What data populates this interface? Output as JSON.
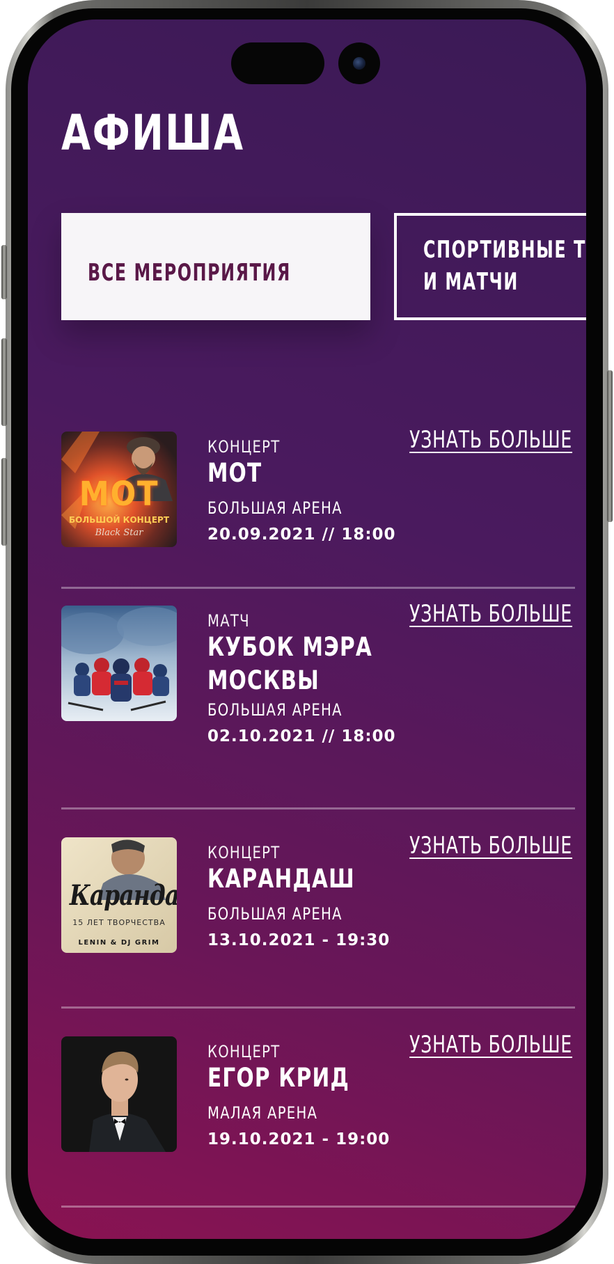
{
  "header": {
    "title": "АФИША"
  },
  "filters": {
    "tabs": [
      {
        "label": "ВСЕ МЕРОПРИЯТИЯ",
        "active": true
      },
      {
        "label": "СПОРТИВНЫЕ ТУ\nИ МАТЧИ",
        "active": false
      }
    ]
  },
  "events": [
    {
      "category": "КОНЦЕРТ",
      "title": "МОТ",
      "venue": "БОЛЬШАЯ АРЕНА",
      "datetime": "20.09.2021 // 18:00",
      "more_label": "УЗНАТЬ БОЛЬШЕ",
      "poster": {
        "text": "МОТ",
        "subtext": "БОЛЬШОЙ КОНЦЕРТ",
        "signature": "Black Star"
      }
    },
    {
      "category": "МАТЧ",
      "title": "КУБОК МЭРА\nМОСКВЫ",
      "venue": "БОЛЬШАЯ АРЕНА",
      "datetime": "02.10.2021 // 18:00",
      "more_label": "УЗНАТЬ БОЛЬШЕ"
    },
    {
      "category": "КОНЦЕРТ",
      "title": "КАРАНДАШ",
      "venue": "БОЛЬШАЯ АРЕНА",
      "datetime": "13.10.2021 - 19:30",
      "more_label": "УЗНАТЬ БОЛЬШЕ",
      "poster": {
        "text": "Карандаш",
        "subtext": "15 ЛЕТ ТВОРЧЕСТВА",
        "guests": "LENIN & DJ GRIM"
      }
    },
    {
      "category": "КОНЦЕРТ",
      "title": "ЕГОР КРИД",
      "venue": "МАЛАЯ АРЕНА",
      "datetime": "19.10.2021 - 19:00",
      "more_label": "УЗНАТЬ БОЛЬШЕ"
    }
  ],
  "colors": {
    "background_top": "#3b1a56",
    "background_bottom": "#8a1352",
    "active_tab_bg": "#f7f5f8",
    "active_tab_text": "#5a1848",
    "text": "#ffffff"
  }
}
